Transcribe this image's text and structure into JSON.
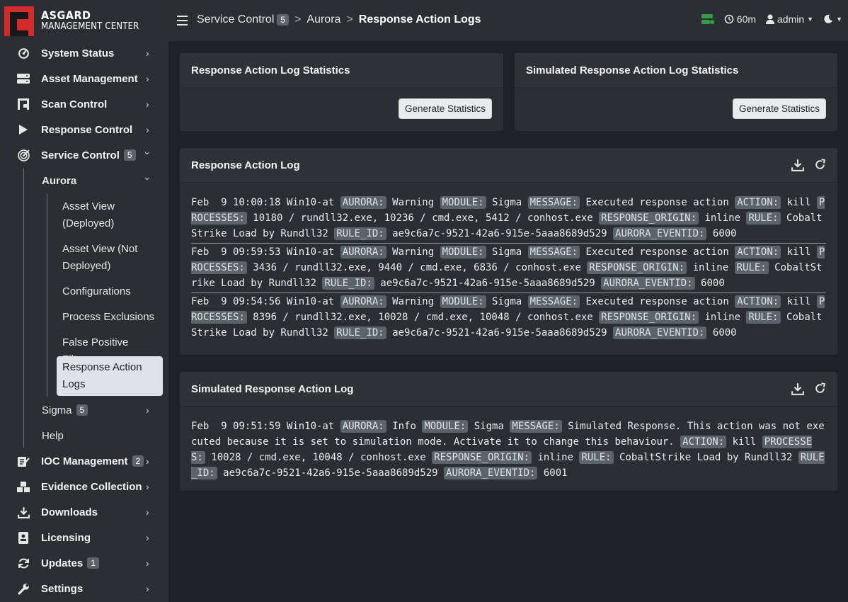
{
  "brand": {
    "line1": "ASGARD",
    "line2": "MANAGEMENT CENTER"
  },
  "sidebar": {
    "items": [
      {
        "label": "System Status",
        "icon": "gauge-icon"
      },
      {
        "label": "Asset Management",
        "icon": "server-icon"
      },
      {
        "label": "Scan Control",
        "icon": "scan-icon"
      },
      {
        "label": "Response Control",
        "icon": "play-icon"
      },
      {
        "label": "Service Control",
        "icon": "radar-icon",
        "badge": "5"
      },
      {
        "label": "IOC Management",
        "icon": "ioc-icon",
        "badge": "2"
      },
      {
        "label": "Evidence Collection",
        "icon": "boxes-icon"
      },
      {
        "label": "Downloads",
        "icon": "download-icon"
      },
      {
        "label": "Licensing",
        "icon": "license-icon"
      },
      {
        "label": "Updates",
        "icon": "refresh-icon",
        "badge": "1"
      },
      {
        "label": "Settings",
        "icon": "wrench-icon"
      }
    ],
    "aurora": "Aurora",
    "aurora_children": [
      "Asset View (Deployed)",
      "Asset View (Not Deployed)",
      "Configurations",
      "Process Exclusions",
      "False Positive Filters",
      "Response Action Logs"
    ],
    "sigma": "Sigma",
    "sigma_badge": "5",
    "help": "Help"
  },
  "topbar": {
    "crumb1": "Service Control",
    "crumb1_badge": "5",
    "crumb2": "Aurora",
    "crumb3": "Response Action Logs",
    "sep": ">",
    "timer": "60m",
    "user": "admin",
    "status_color": "#2f9e44"
  },
  "stats": {
    "left_title": "Response Action Log Statistics",
    "right_title": "Simulated Response Action Log Statistics",
    "button": "Generate Statistics"
  },
  "log": {
    "title": "Response Action Log",
    "entries": [
      [
        [
          "t",
          "Feb  9 10:00:18 Win10-at "
        ],
        [
          "k",
          "AURORA:"
        ],
        [
          "t",
          " Warning "
        ],
        [
          "k",
          "MODULE:"
        ],
        [
          "t",
          " Sigma "
        ],
        [
          "k",
          "MESSAGE:"
        ],
        [
          "t",
          " Executed response action "
        ],
        [
          "k",
          "ACTION:"
        ],
        [
          "t",
          " kill "
        ],
        [
          "k",
          "PROCESSES:"
        ],
        [
          "t",
          " 10180 / rundll32.exe, 10236 / cmd.exe, 5412 / conhost.exe "
        ],
        [
          "k",
          "RESPONSE_ORIGIN:"
        ],
        [
          "t",
          " inline "
        ],
        [
          "k",
          "RULE:"
        ],
        [
          "t",
          " CobaltStrike Load by Rundll32 "
        ],
        [
          "k",
          "RULE_ID:"
        ],
        [
          "t",
          " ae9c6a7c-9521-42a6-915e-5aaa8689d529 "
        ],
        [
          "k",
          "AURORA_EVENTID:"
        ],
        [
          "t",
          " 6000"
        ]
      ],
      [
        [
          "t",
          "Feb  9 09:59:53 Win10-at "
        ],
        [
          "k",
          "AURORA:"
        ],
        [
          "t",
          " Warning "
        ],
        [
          "k",
          "MODULE:"
        ],
        [
          "t",
          " Sigma "
        ],
        [
          "k",
          "MESSAGE:"
        ],
        [
          "t",
          " Executed response action "
        ],
        [
          "k",
          "ACTION:"
        ],
        [
          "t",
          " kill "
        ],
        [
          "k",
          "PROCESSES:"
        ],
        [
          "t",
          " 3436 / rundll32.exe, 9440 / cmd.exe, 6836 / conhost.exe "
        ],
        [
          "k",
          "RESPONSE_ORIGIN:"
        ],
        [
          "t",
          " inline "
        ],
        [
          "k",
          "RULE:"
        ],
        [
          "t",
          " CobaltStrike Load by Rundll32 "
        ],
        [
          "k",
          "RULE_ID:"
        ],
        [
          "t",
          " ae9c6a7c-9521-42a6-915e-5aaa8689d529 "
        ],
        [
          "k",
          "AURORA_EVENTID:"
        ],
        [
          "t",
          " 6000"
        ]
      ],
      [
        [
          "t",
          "Feb  9 09:54:56 Win10-at "
        ],
        [
          "k",
          "AURORA:"
        ],
        [
          "t",
          " Warning "
        ],
        [
          "k",
          "MODULE:"
        ],
        [
          "t",
          " Sigma "
        ],
        [
          "k",
          "MESSAGE:"
        ],
        [
          "t",
          " Executed response action "
        ],
        [
          "k",
          "ACTION:"
        ],
        [
          "t",
          " kill "
        ],
        [
          "k",
          "PROCESSES:"
        ],
        [
          "t",
          " 8396 / rundll32.exe, 10028 / cmd.exe, 10048 / conhost.exe "
        ],
        [
          "k",
          "RESPONSE_ORIGIN:"
        ],
        [
          "t",
          " inline "
        ],
        [
          "k",
          "RULE:"
        ],
        [
          "t",
          " CobaltStrike Load by Rundll32 "
        ],
        [
          "k",
          "RULE_ID:"
        ],
        [
          "t",
          " ae9c6a7c-9521-42a6-915e-5aaa8689d529 "
        ],
        [
          "k",
          "AURORA_EVENTID:"
        ],
        [
          "t",
          " 6000"
        ]
      ]
    ]
  },
  "simlog": {
    "title": "Simulated Response Action Log",
    "entries": [
      [
        [
          "t",
          "Feb  9 09:51:59 Win10-at "
        ],
        [
          "k",
          "AURORA:"
        ],
        [
          "t",
          " Info "
        ],
        [
          "k",
          "MODULE:"
        ],
        [
          "t",
          " Sigma "
        ],
        [
          "k",
          "MESSAGE:"
        ],
        [
          "t",
          " Simulated Response. This action was not executed because it is set to simulation mode. Activate it to change this behaviour. "
        ],
        [
          "k",
          "ACTION:"
        ],
        [
          "t",
          " kill "
        ],
        [
          "k",
          "PROCESSES:"
        ],
        [
          "t",
          " 10028 / cmd.exe, 10048 / conhost.exe "
        ],
        [
          "k",
          "RESPONSE_ORIGIN:"
        ],
        [
          "t",
          " inline "
        ],
        [
          "k",
          "RULE:"
        ],
        [
          "t",
          " CobaltStrike Load by Rundll32 "
        ],
        [
          "k",
          "RULE_ID:"
        ],
        [
          "t",
          " ae9c6a7c-9521-42a6-915e-5aaa8689d529 "
        ],
        [
          "k",
          "AURORA_EVENTID:"
        ],
        [
          "t",
          " 6001"
        ]
      ]
    ]
  }
}
